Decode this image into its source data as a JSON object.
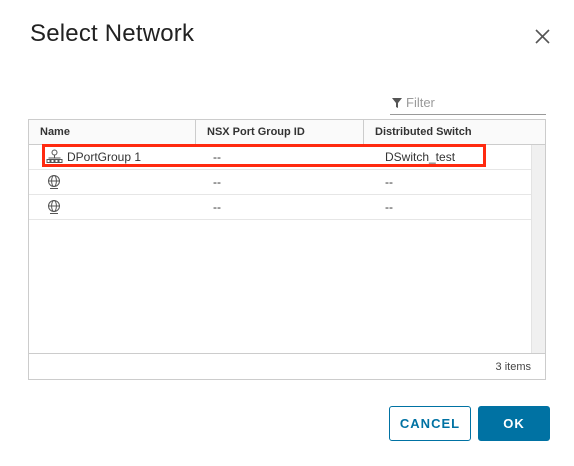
{
  "dialog": {
    "title": "Select Network",
    "close_icon": "close-icon"
  },
  "filter": {
    "placeholder": "Filter",
    "value": "",
    "icon": "filter-icon"
  },
  "table": {
    "columns": [
      "Name",
      "NSX Port Group ID",
      "Distributed Switch"
    ],
    "rows": [
      {
        "icon": "distributed-portgroup-icon",
        "name": "DPortGroup 1",
        "nsx_id": "--",
        "switch": "DSwitch_test"
      },
      {
        "icon": "network-icon",
        "name": "",
        "nsx_id": "--",
        "switch": "--"
      },
      {
        "icon": "network-icon",
        "name": "",
        "nsx_id": "--",
        "switch": "--"
      }
    ],
    "footer_count": "3 items"
  },
  "buttons": {
    "cancel": "CANCEL",
    "ok": "OK"
  },
  "colors": {
    "accent": "#0072a3",
    "highlight": "#ff2a10"
  }
}
